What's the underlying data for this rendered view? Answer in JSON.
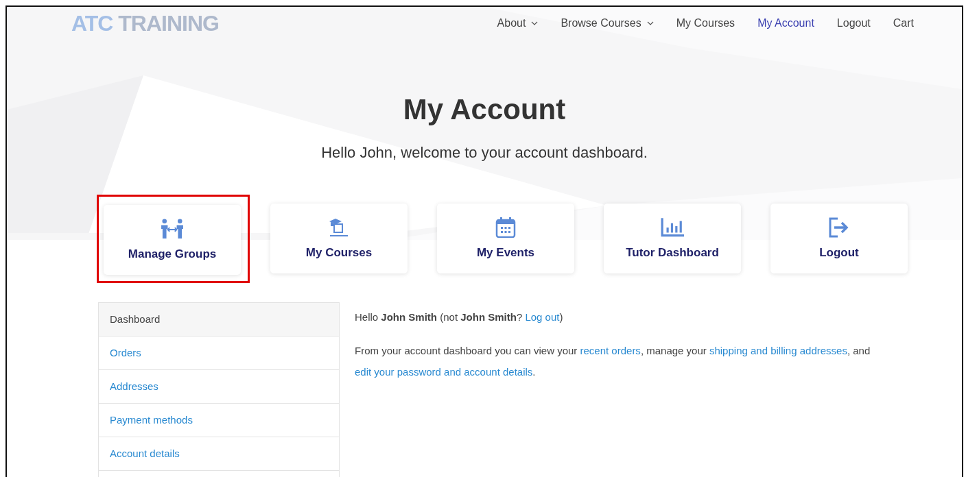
{
  "logo": {
    "part_1": "ATC",
    "part_2": "TRAINING"
  },
  "nav": [
    {
      "label": "About",
      "has_dropdown": true,
      "selected": false
    },
    {
      "label": "Browse Courses",
      "has_dropdown": true,
      "selected": false
    },
    {
      "label": "My Courses",
      "has_dropdown": false,
      "selected": false
    },
    {
      "label": "My Account",
      "has_dropdown": false,
      "selected": true
    },
    {
      "label": "Logout",
      "has_dropdown": false,
      "selected": false
    },
    {
      "label": "Cart",
      "has_dropdown": false,
      "selected": false
    }
  ],
  "title": "My Account",
  "subtitle": "Hello John, welcome to your account dashboard.",
  "tiles": [
    {
      "label": "Manage Groups",
      "highlighted": true
    },
    {
      "label": "My Courses",
      "highlighted": false
    },
    {
      "label": "My Events",
      "highlighted": false
    },
    {
      "label": "Tutor Dashboard",
      "highlighted": false
    },
    {
      "label": "Logout",
      "highlighted": false
    }
  ],
  "sidebar": {
    "items": [
      {
        "label": "Dashboard",
        "selected": true
      },
      {
        "label": "Orders",
        "selected": false
      },
      {
        "label": "Addresses",
        "selected": false
      },
      {
        "label": "Payment methods",
        "selected": false
      },
      {
        "label": "Account details",
        "selected": false
      }
    ]
  },
  "content": {
    "paragraphs": [
      [
        {
          "kind": "text",
          "text": "Hello **John Smith** (not **John Smith**? "
        },
        {
          "kind": "link",
          "text": "Log out"
        },
        {
          "kind": "text",
          "text": ")"
        }
      ],
      [
        {
          "kind": "text",
          "text": "From your account dashboard you can view your "
        },
        {
          "kind": "link",
          "text": "recent orders"
        },
        {
          "kind": "text",
          "text": ", manage your "
        },
        {
          "kind": "link",
          "text": "shipping and billing addresses"
        },
        {
          "kind": "text",
          "text": ", and "
        },
        {
          "kind": "link",
          "text": "edit your password and account details"
        },
        {
          "kind": "text",
          "text": "."
        }
      ]
    ]
  }
}
